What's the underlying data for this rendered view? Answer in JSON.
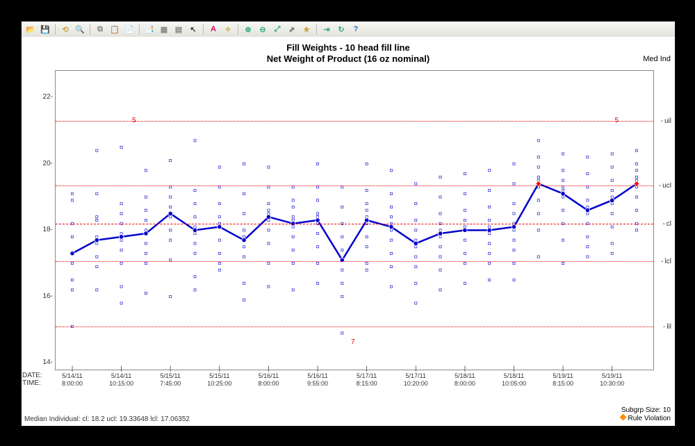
{
  "toolbar_icons": [
    "open-icon",
    "save-icon",
    "home-icon",
    "search-icon",
    "copy-icon",
    "paste-icon",
    "doc1-icon",
    "doc2-icon",
    "layout-icon",
    "chart-icon",
    "pointer-icon",
    "abc-icon",
    "wand-icon",
    "zoomin-icon",
    "zoomout-icon",
    "zoomfit-icon",
    "cursor-icon",
    "star-icon",
    "export-icon",
    "refresh-icon",
    "help-icon"
  ],
  "titles": {
    "line1": "Fill Weights - 10 head fill line",
    "line2": "Net Weight of Product (16 oz nominal)",
    "right": "Med Ind"
  },
  "yaxis": {
    "min": 13.8,
    "max": 22.8,
    "ticks": [
      14,
      16,
      18,
      20,
      22
    ],
    "label_date": "DATE:",
    "label_time": "TIME:"
  },
  "control_lines": {
    "uil": 21.3,
    "ucl": 19.34,
    "cl": 18.2,
    "lcl": 17.06,
    "lil": 15.1
  },
  "zones": {
    "upper": "5",
    "lower": "7"
  },
  "footer": {
    "left": "Median Individual:   cl:   18.2   ucl:   19.33648   lcl:   17.06352",
    "right1": "Subgrp Size: 10",
    "right2": "Rule Violation"
  },
  "chart_data": {
    "type": "line",
    "title": "Fill Weights - 10 head fill line — Net Weight of Product (16 oz nominal)",
    "xlabel": "DATE / TIME",
    "ylabel": "",
    "ylim": [
      13.8,
      22.8
    ],
    "categories": [
      {
        "d": "5/14/11",
        "t": "8:00:00"
      },
      {
        "d": "5/14/11",
        "t": "10:15:00"
      },
      {
        "d": "5/15/11",
        "t": "7:45:00"
      },
      {
        "d": "5/15/11",
        "t": "10:25:00"
      },
      {
        "d": "5/16/11",
        "t": "8:00:00"
      },
      {
        "d": "5/16/11",
        "t": "9:55:00"
      },
      {
        "d": "5/17/11",
        "t": "8:15:00"
      },
      {
        "d": "5/17/11",
        "t": "10:20:00"
      },
      {
        "d": "5/18/11",
        "t": "8:00:00"
      },
      {
        "d": "5/18/11",
        "t": "10:05:00"
      },
      {
        "d": "5/19/11",
        "t": "8:15:00"
      },
      {
        "d": "5/19/11",
        "t": "10:30:00"
      }
    ],
    "n_subgroups": 24,
    "series": [
      {
        "name": "Median Individual",
        "values": [
          17.3,
          17.7,
          17.8,
          17.9,
          18.5,
          18.0,
          18.1,
          17.7,
          18.4,
          18.2,
          18.3,
          17.1,
          18.3,
          18.1,
          17.6,
          17.9,
          18.0,
          18.0,
          18.1,
          19.4,
          19.1,
          18.6,
          18.9,
          19.4
        ],
        "violations": [
          false,
          false,
          false,
          false,
          false,
          false,
          false,
          false,
          false,
          false,
          false,
          false,
          false,
          false,
          false,
          false,
          false,
          false,
          false,
          true,
          false,
          false,
          false,
          true
        ]
      }
    ],
    "subgroup_scatter": [
      [
        19.1,
        18.9,
        18.2,
        17.8,
        17.3,
        17.3,
        17.0,
        16.5,
        16.2,
        15.1
      ],
      [
        20.4,
        19.1,
        18.4,
        18.3,
        17.8,
        17.7,
        17.6,
        17.2,
        16.9,
        16.2
      ],
      [
        20.5,
        18.8,
        18.5,
        18.2,
        17.9,
        17.7,
        17.4,
        17.0,
        16.3,
        15.8
      ],
      [
        19.8,
        19.0,
        18.6,
        18.3,
        18.0,
        17.9,
        17.6,
        17.3,
        17.0,
        16.1
      ],
      [
        20.1,
        19.3,
        19.0,
        18.7,
        18.5,
        18.4,
        18.0,
        17.7,
        17.1,
        16.0
      ],
      [
        20.7,
        19.2,
        18.8,
        18.4,
        18.1,
        17.9,
        17.6,
        17.3,
        16.6,
        16.2
      ],
      [
        19.9,
        19.3,
        18.8,
        18.4,
        18.2,
        18.1,
        17.7,
        17.3,
        17.0,
        16.8
      ],
      [
        20.0,
        19.1,
        18.5,
        18.0,
        17.8,
        17.7,
        17.5,
        17.2,
        16.4,
        15.9
      ],
      [
        19.9,
        19.3,
        18.8,
        18.6,
        18.5,
        18.3,
        18.0,
        17.6,
        17.0,
        16.3
      ],
      [
        19.3,
        18.9,
        18.7,
        18.4,
        18.3,
        18.1,
        17.8,
        17.4,
        17.0,
        16.2
      ],
      [
        20.0,
        19.3,
        18.9,
        18.5,
        18.4,
        18.2,
        17.9,
        17.5,
        17.0,
        16.4
      ],
      [
        19.3,
        18.7,
        18.2,
        17.8,
        17.4,
        17.1,
        16.8,
        16.4,
        16.0,
        14.9
      ],
      [
        20.0,
        19.2,
        18.8,
        18.6,
        18.4,
        18.2,
        17.8,
        17.5,
        17.0,
        16.8
      ],
      [
        19.8,
        19.1,
        18.7,
        18.4,
        18.2,
        18.0,
        17.7,
        17.3,
        16.9,
        16.3
      ],
      [
        19.4,
        18.8,
        18.3,
        18.0,
        17.7,
        17.5,
        17.2,
        16.9,
        16.4,
        15.8
      ],
      [
        19.6,
        19.0,
        18.5,
        18.2,
        18.0,
        17.8,
        17.5,
        17.2,
        16.8,
        16.2
      ],
      [
        19.7,
        19.1,
        18.6,
        18.3,
        18.1,
        18.0,
        17.7,
        17.3,
        17.0,
        16.4
      ],
      [
        19.8,
        19.2,
        18.7,
        18.3,
        18.1,
        17.9,
        17.6,
        17.3,
        17.0,
        16.5
      ],
      [
        20.0,
        19.4,
        18.8,
        18.5,
        18.2,
        18.0,
        17.7,
        17.4,
        17.0,
        16.5
      ],
      [
        20.7,
        20.2,
        19.9,
        19.6,
        19.5,
        19.3,
        18.9,
        18.5,
        18.0,
        17.2
      ],
      [
        20.3,
        19.8,
        19.5,
        19.3,
        19.2,
        19.0,
        18.6,
        18.2,
        17.7,
        17.0
      ],
      [
        20.2,
        19.7,
        19.3,
        18.9,
        18.7,
        18.5,
        18.2,
        17.8,
        17.5,
        17.2
      ],
      [
        20.3,
        19.9,
        19.5,
        19.2,
        19.0,
        18.8,
        18.5,
        18.1,
        17.6,
        17.3
      ],
      [
        20.4,
        20.0,
        19.8,
        19.6,
        19.5,
        19.3,
        19.0,
        18.6,
        18.2,
        18.0
      ]
    ]
  }
}
